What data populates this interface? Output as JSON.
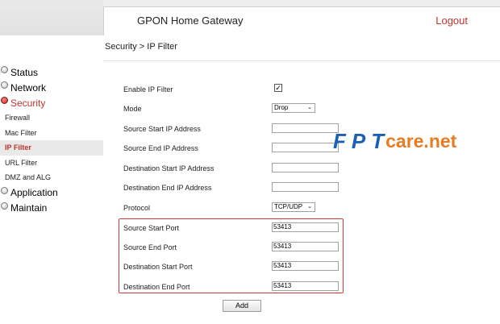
{
  "header": {
    "title": "GPON Home Gateway",
    "logout": "Logout"
  },
  "breadcrumb": "Security > IP Filter",
  "sidebar": {
    "status": "Status",
    "network": "Network",
    "security": "Security",
    "firewall": "Firewall",
    "mac_filter": "Mac Filter",
    "ip_filter": "IP Filter",
    "url_filter": "URL Filter",
    "dmz_alg": "DMZ and ALG",
    "application": "Application",
    "maintain": "Maintain"
  },
  "form": {
    "enable_label": "Enable IP Filter",
    "enable_checked": "✓",
    "mode_label": "Mode",
    "mode_value": "Drop",
    "src_start_ip_label": "Source Start IP Address",
    "src_end_ip_label": "Source End IP Address",
    "dst_start_ip_label": "Destination Start IP Address",
    "dst_end_ip_label": "Destination End IP Address",
    "protocol_label": "Protocol",
    "protocol_value": "TCP/UDP",
    "src_start_port_label": "Source Start Port",
    "src_start_port_value": "53413",
    "src_end_port_label": "Source End Port",
    "src_end_port_value": "53413",
    "dst_start_port_label": "Destination Start Port",
    "dst_start_port_value": "53413",
    "dst_end_port_label": "Destination End Port",
    "dst_end_port_value": "53413",
    "add_button": "Add"
  },
  "watermark": {
    "part1": "FPT",
    "part2": "care.net"
  },
  "colors": {
    "accent_red": "#c0332d",
    "watermark_blue": "#1a60b5",
    "watermark_orange": "#e97b22"
  }
}
